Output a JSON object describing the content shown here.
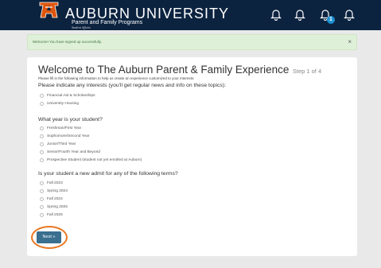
{
  "header": {
    "title": "AUBURN UNIVERSITY",
    "subtitle": "Parent and Family Programs",
    "tagline": "Student Affairs",
    "notification_badge": "1",
    "colors": {
      "navy": "#0c2340",
      "orange": "#dd550c",
      "badge": "#1d8fd1"
    }
  },
  "alert": {
    "message": "Welcome! You have signed up successfully.",
    "close": "×"
  },
  "form": {
    "heading": "Welcome to The Auburn Parent & Family Experience",
    "step": "Step 1 of 4",
    "intro": "Please fill in the following information to help us create an experience customized to your interests:",
    "q1": {
      "label": "Please indicate any interests (you'll get regular news and info on these topics):",
      "options": [
        "Financial Aid & Scholarships",
        "University Housing"
      ]
    },
    "q2": {
      "label": "What year is your student?",
      "options": [
        "Freshman/First Year",
        "Sophomore/Second Year",
        "Junior/Third Year",
        "Senior/Fourth Year and Beyond",
        "Prospective Student (student not yet enrolled at Auburn)"
      ]
    },
    "q3": {
      "label": "Is your student a new admit for any of the following terms?",
      "options": [
        "Fall 2023",
        "Spring 2024",
        "Fall 2024",
        "Spring 2025",
        "Fall 2025"
      ]
    },
    "next_label": "Next »"
  }
}
